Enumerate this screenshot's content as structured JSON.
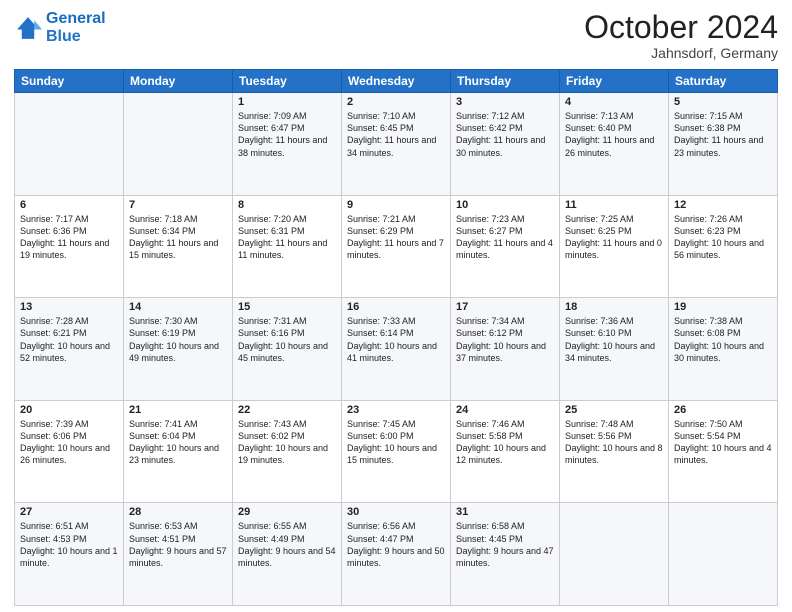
{
  "header": {
    "logo_line1": "General",
    "logo_line2": "Blue",
    "month": "October 2024",
    "location": "Jahnsdorf, Germany"
  },
  "weekdays": [
    "Sunday",
    "Monday",
    "Tuesday",
    "Wednesday",
    "Thursday",
    "Friday",
    "Saturday"
  ],
  "weeks": [
    [
      {
        "day": "",
        "sunrise": "",
        "sunset": "",
        "daylight": ""
      },
      {
        "day": "",
        "sunrise": "",
        "sunset": "",
        "daylight": ""
      },
      {
        "day": "1",
        "sunrise": "Sunrise: 7:09 AM",
        "sunset": "Sunset: 6:47 PM",
        "daylight": "Daylight: 11 hours and 38 minutes."
      },
      {
        "day": "2",
        "sunrise": "Sunrise: 7:10 AM",
        "sunset": "Sunset: 6:45 PM",
        "daylight": "Daylight: 11 hours and 34 minutes."
      },
      {
        "day": "3",
        "sunrise": "Sunrise: 7:12 AM",
        "sunset": "Sunset: 6:42 PM",
        "daylight": "Daylight: 11 hours and 30 minutes."
      },
      {
        "day": "4",
        "sunrise": "Sunrise: 7:13 AM",
        "sunset": "Sunset: 6:40 PM",
        "daylight": "Daylight: 11 hours and 26 minutes."
      },
      {
        "day": "5",
        "sunrise": "Sunrise: 7:15 AM",
        "sunset": "Sunset: 6:38 PM",
        "daylight": "Daylight: 11 hours and 23 minutes."
      }
    ],
    [
      {
        "day": "6",
        "sunrise": "Sunrise: 7:17 AM",
        "sunset": "Sunset: 6:36 PM",
        "daylight": "Daylight: 11 hours and 19 minutes."
      },
      {
        "day": "7",
        "sunrise": "Sunrise: 7:18 AM",
        "sunset": "Sunset: 6:34 PM",
        "daylight": "Daylight: 11 hours and 15 minutes."
      },
      {
        "day": "8",
        "sunrise": "Sunrise: 7:20 AM",
        "sunset": "Sunset: 6:31 PM",
        "daylight": "Daylight: 11 hours and 11 minutes."
      },
      {
        "day": "9",
        "sunrise": "Sunrise: 7:21 AM",
        "sunset": "Sunset: 6:29 PM",
        "daylight": "Daylight: 11 hours and 7 minutes."
      },
      {
        "day": "10",
        "sunrise": "Sunrise: 7:23 AM",
        "sunset": "Sunset: 6:27 PM",
        "daylight": "Daylight: 11 hours and 4 minutes."
      },
      {
        "day": "11",
        "sunrise": "Sunrise: 7:25 AM",
        "sunset": "Sunset: 6:25 PM",
        "daylight": "Daylight: 11 hours and 0 minutes."
      },
      {
        "day": "12",
        "sunrise": "Sunrise: 7:26 AM",
        "sunset": "Sunset: 6:23 PM",
        "daylight": "Daylight: 10 hours and 56 minutes."
      }
    ],
    [
      {
        "day": "13",
        "sunrise": "Sunrise: 7:28 AM",
        "sunset": "Sunset: 6:21 PM",
        "daylight": "Daylight: 10 hours and 52 minutes."
      },
      {
        "day": "14",
        "sunrise": "Sunrise: 7:30 AM",
        "sunset": "Sunset: 6:19 PM",
        "daylight": "Daylight: 10 hours and 49 minutes."
      },
      {
        "day": "15",
        "sunrise": "Sunrise: 7:31 AM",
        "sunset": "Sunset: 6:16 PM",
        "daylight": "Daylight: 10 hours and 45 minutes."
      },
      {
        "day": "16",
        "sunrise": "Sunrise: 7:33 AM",
        "sunset": "Sunset: 6:14 PM",
        "daylight": "Daylight: 10 hours and 41 minutes."
      },
      {
        "day": "17",
        "sunrise": "Sunrise: 7:34 AM",
        "sunset": "Sunset: 6:12 PM",
        "daylight": "Daylight: 10 hours and 37 minutes."
      },
      {
        "day": "18",
        "sunrise": "Sunrise: 7:36 AM",
        "sunset": "Sunset: 6:10 PM",
        "daylight": "Daylight: 10 hours and 34 minutes."
      },
      {
        "day": "19",
        "sunrise": "Sunrise: 7:38 AM",
        "sunset": "Sunset: 6:08 PM",
        "daylight": "Daylight: 10 hours and 30 minutes."
      }
    ],
    [
      {
        "day": "20",
        "sunrise": "Sunrise: 7:39 AM",
        "sunset": "Sunset: 6:06 PM",
        "daylight": "Daylight: 10 hours and 26 minutes."
      },
      {
        "day": "21",
        "sunrise": "Sunrise: 7:41 AM",
        "sunset": "Sunset: 6:04 PM",
        "daylight": "Daylight: 10 hours and 23 minutes."
      },
      {
        "day": "22",
        "sunrise": "Sunrise: 7:43 AM",
        "sunset": "Sunset: 6:02 PM",
        "daylight": "Daylight: 10 hours and 19 minutes."
      },
      {
        "day": "23",
        "sunrise": "Sunrise: 7:45 AM",
        "sunset": "Sunset: 6:00 PM",
        "daylight": "Daylight: 10 hours and 15 minutes."
      },
      {
        "day": "24",
        "sunrise": "Sunrise: 7:46 AM",
        "sunset": "Sunset: 5:58 PM",
        "daylight": "Daylight: 10 hours and 12 minutes."
      },
      {
        "day": "25",
        "sunrise": "Sunrise: 7:48 AM",
        "sunset": "Sunset: 5:56 PM",
        "daylight": "Daylight: 10 hours and 8 minutes."
      },
      {
        "day": "26",
        "sunrise": "Sunrise: 7:50 AM",
        "sunset": "Sunset: 5:54 PM",
        "daylight": "Daylight: 10 hours and 4 minutes."
      }
    ],
    [
      {
        "day": "27",
        "sunrise": "Sunrise: 6:51 AM",
        "sunset": "Sunset: 4:53 PM",
        "daylight": "Daylight: 10 hours and 1 minute."
      },
      {
        "day": "28",
        "sunrise": "Sunrise: 6:53 AM",
        "sunset": "Sunset: 4:51 PM",
        "daylight": "Daylight: 9 hours and 57 minutes."
      },
      {
        "day": "29",
        "sunrise": "Sunrise: 6:55 AM",
        "sunset": "Sunset: 4:49 PM",
        "daylight": "Daylight: 9 hours and 54 minutes."
      },
      {
        "day": "30",
        "sunrise": "Sunrise: 6:56 AM",
        "sunset": "Sunset: 4:47 PM",
        "daylight": "Daylight: 9 hours and 50 minutes."
      },
      {
        "day": "31",
        "sunrise": "Sunrise: 6:58 AM",
        "sunset": "Sunset: 4:45 PM",
        "daylight": "Daylight: 9 hours and 47 minutes."
      },
      {
        "day": "",
        "sunrise": "",
        "sunset": "",
        "daylight": ""
      },
      {
        "day": "",
        "sunrise": "",
        "sunset": "",
        "daylight": ""
      }
    ]
  ]
}
